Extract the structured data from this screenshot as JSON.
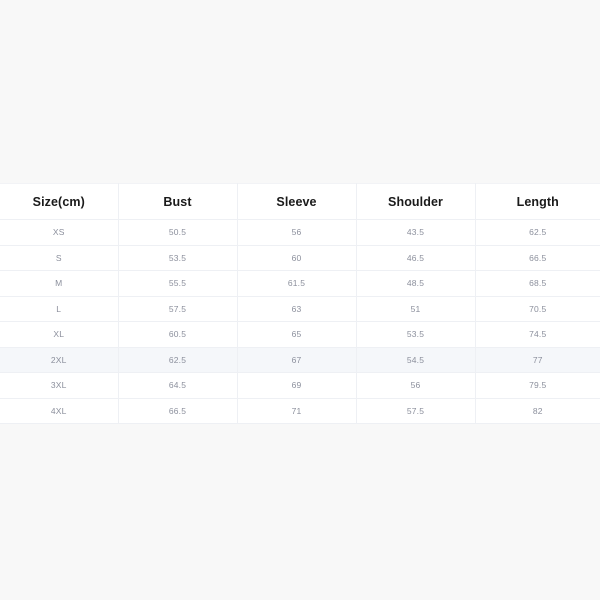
{
  "page": {
    "background_color": "#f8f8f8",
    "table_background_color": "#ffffff",
    "border_color": "#eef0f4",
    "header_text_color": "#1a1a1a",
    "cell_text_color": "#8b8f9c",
    "highlight_row_color": "#f5f7fa"
  },
  "size_chart": {
    "unit_note": "Size(cm)",
    "headers": [
      "Size(cm)",
      "Bust",
      "Sleeve",
      "Shoulder",
      "Length"
    ],
    "highlighted_row_index": 5,
    "rows": [
      {
        "size": "XS",
        "bust": "50.5",
        "sleeve": "56",
        "shoulder": "43.5",
        "length": "62.5"
      },
      {
        "size": "S",
        "bust": "53.5",
        "sleeve": "60",
        "shoulder": "46.5",
        "length": "66.5"
      },
      {
        "size": "M",
        "bust": "55.5",
        "sleeve": "61.5",
        "shoulder": "48.5",
        "length": "68.5"
      },
      {
        "size": "L",
        "bust": "57.5",
        "sleeve": "63",
        "shoulder": "51",
        "length": "70.5"
      },
      {
        "size": "XL",
        "bust": "60.5",
        "sleeve": "65",
        "shoulder": "53.5",
        "length": "74.5"
      },
      {
        "size": "2XL",
        "bust": "62.5",
        "sleeve": "67",
        "shoulder": "54.5",
        "length": "77"
      },
      {
        "size": "3XL",
        "bust": "64.5",
        "sleeve": "69",
        "shoulder": "56",
        "length": "79.5"
      },
      {
        "size": "4XL",
        "bust": "66.5",
        "sleeve": "71",
        "shoulder": "57.5",
        "length": "82"
      }
    ]
  }
}
